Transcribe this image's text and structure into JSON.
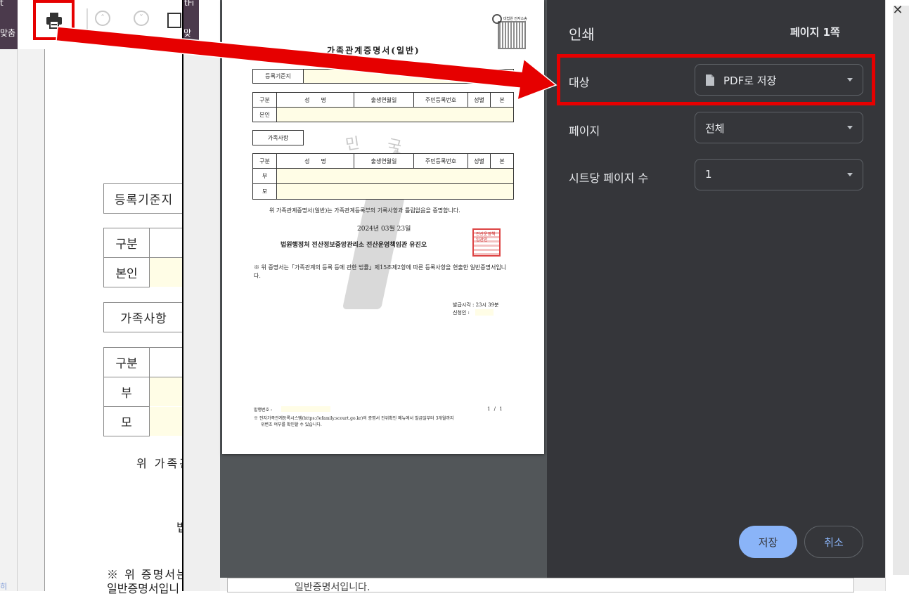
{
  "background_viewer": {
    "strip_text_top": "t",
    "strip_text_mid": "맞춤",
    "strip_text_bottom": "히",
    "toolbar": {
      "prev_glyph": "˄",
      "next_glyph": "˅"
    },
    "doc": {
      "reg_label": "등록기준지",
      "col_gubun": "구분",
      "row_self": "본인",
      "family_label": "가족사항",
      "col_gubun2": "구분",
      "row_father": "부",
      "row_mother": "모",
      "line_wi": "위 가족관",
      "line_frag": "법",
      "note_line1": "※ 위 증명서는",
      "note_line2": "일반증명서입니"
    }
  },
  "middle_viewer": {
    "strip_text_top": "tFi",
    "strip_text_mid": "맞춤",
    "bottom_text": "일반증명서입니다."
  },
  "certificate": {
    "title": "가족관계증명서(일반)",
    "qr_caption": "대법원 전자소송",
    "reg_label": "등록기준지",
    "headers": [
      "구분",
      "성　　명",
      "출생연월일",
      "주민등록번호",
      "성별",
      "본"
    ],
    "self_label": "본인",
    "family_label": "가족사항",
    "family_rows": [
      "부",
      "모"
    ],
    "statement": "위 가족관계증명서(일반)는 가족관계등록부의 기록사항과 틀림없음을 증명합니다.",
    "date": "2024년 03월 23일",
    "issuer": "법원행정처 전산정보중앙관리소 전산운영책임관 유진오",
    "seal_text": "전산운영책임관인",
    "note": "※ 위 증명서는「가족관계의 등록 등에 관한 법률」제15조제2항에 따른 등록사항을 현출한 일반증명서입니다.",
    "issue_time": "발급시각 : 23시 39분",
    "applicant": "신청인 :",
    "issue_no_label": "발행번호 :",
    "page_count": "1 / 1",
    "footer_line1": "※ 전자가족관계등록시스템(https://efamily.scourt.go.kr)의 증명서 진위확인 메뉴에서 발급일부터 3개월까지",
    "footer_line2": "위변조 여부를 확인할 수 있습니다.",
    "watermark_1": "민",
    "watermark_2": "국"
  },
  "print_dialog": {
    "title": "인쇄",
    "page_count": "페이지 1쪽",
    "destination": {
      "label": "대상",
      "value": "PDF로 저장"
    },
    "pages": {
      "label": "페이지",
      "value": "전체"
    },
    "pages_per_sheet": {
      "label": "시트당 페이지 수",
      "value": "1"
    },
    "save_button": "저장",
    "cancel_button": "취소"
  },
  "window": {
    "close_glyph": "✕"
  },
  "colors": {
    "annotation": "#e60000",
    "dialog_bg": "#35363a",
    "preview_bg": "#525659",
    "save_button": "#8ab4f8",
    "field_fill": "#fffde6"
  }
}
